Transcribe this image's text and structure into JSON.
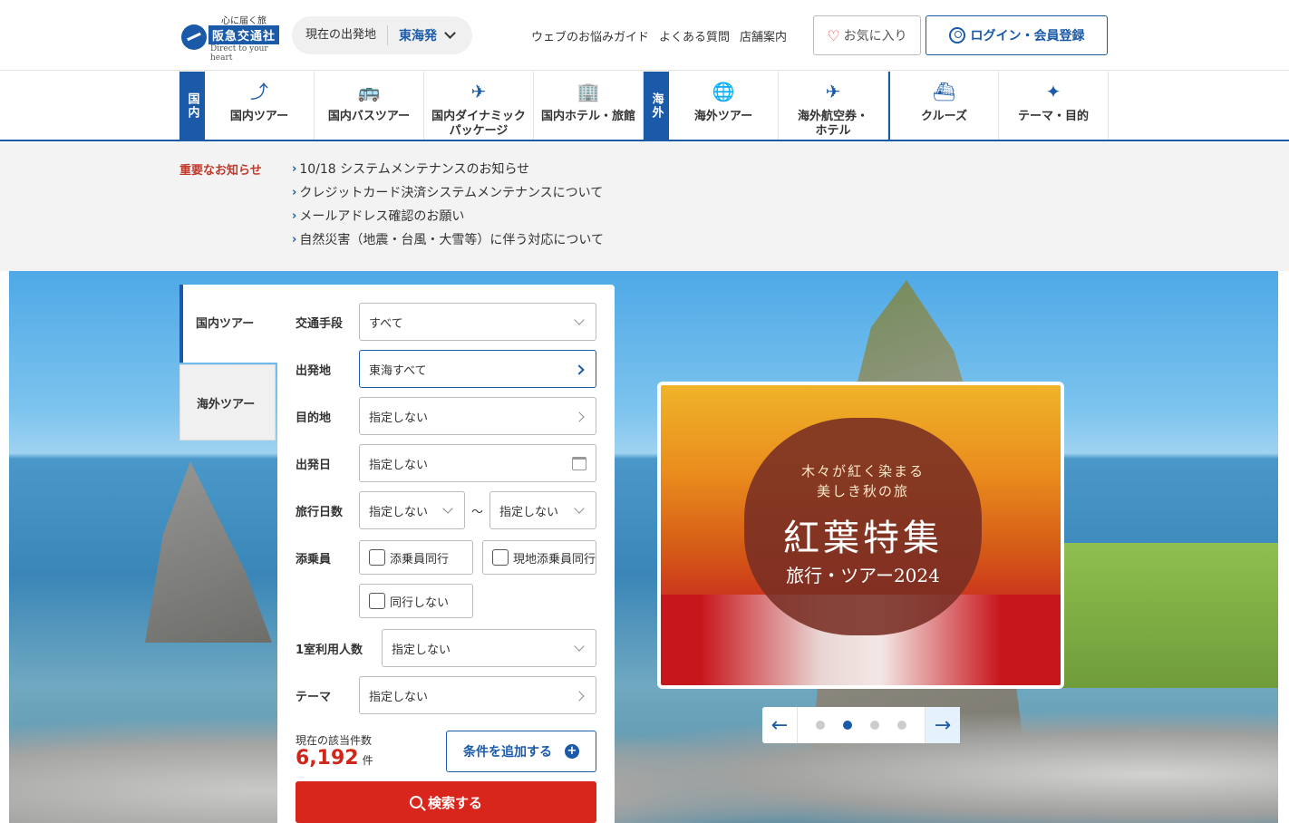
{
  "header": {
    "logo_tag": "心に届く旅",
    "logo_name": "阪急交通社",
    "logo_en": "Direct to your heart",
    "departure_label": "現在の出発地",
    "departure_value": "東海発",
    "links": [
      "ウェブのお悩みガイド",
      "よくある質問",
      "店舗案内"
    ],
    "favorite_label": "お気に入り",
    "login_label": "ログイン・会員登録"
  },
  "nav": {
    "domestic_tab": "国内",
    "overseas_tab": "海外",
    "items": [
      {
        "label": "国内ツアー",
        "icon": "route-icon",
        "glyph": "⤴"
      },
      {
        "label": "国内バスツアー",
        "icon": "bus-icon",
        "glyph": "🚌"
      },
      {
        "label": "国内ダイナミック\nパッケージ",
        "icon": "plane-hotel-icon",
        "glyph": "✈"
      },
      {
        "label": "国内ホテル・旅館",
        "icon": "hotel-icon",
        "glyph": "🏢"
      },
      {
        "label": "海外ツアー",
        "icon": "globe-icon",
        "glyph": "🌐"
      },
      {
        "label": "海外航空券・\nホテル",
        "icon": "plane-hotel-icon",
        "glyph": "✈"
      },
      {
        "label": "クルーズ",
        "icon": "ship-icon",
        "glyph": "⛴"
      },
      {
        "label": "テーマ・目的",
        "icon": "sparkle-icon",
        "glyph": "✦"
      }
    ]
  },
  "notices": {
    "title": "重要なお知らせ",
    "items": [
      "10/18 システムメンテナンスのお知らせ",
      "クレジットカード決済システムメンテナンスについて",
      "メールアドレス確認のお願い",
      "自然災害（地震・台風・大雪等）に伴う対応について"
    ]
  },
  "search": {
    "tab_domestic": "国内ツアー",
    "tab_overseas": "海外ツアー",
    "transport_label": "交通手段",
    "transport_value": "すべて",
    "departure_label": "出発地",
    "departure_value": "東海すべて",
    "destination_label": "目的地",
    "destination_value": "指定しない",
    "date_label": "出発日",
    "date_value": "指定しない",
    "days_label": "旅行日数",
    "days_from": "指定しない",
    "days_sep": "～",
    "days_to": "指定しない",
    "guide_label": "添乗員",
    "guide_opt1": "添乗員同行",
    "guide_opt2": "現地添乗員同行",
    "guide_opt3": "同行しない",
    "room_label": "1室利用人数",
    "room_value": "指定しない",
    "theme_label": "テーマ",
    "theme_value": "指定しない",
    "count_label": "現在の該当件数",
    "count_value": "6,192",
    "count_unit": "件",
    "add_label": "条件を追加する",
    "search_label": "検索する"
  },
  "banner": {
    "line1": "木々が紅く染まる",
    "line2": "美しき秋の旅",
    "title": "紅葉特集",
    "subtitle": "旅行・ツアー2024"
  },
  "carousel": {
    "total": 4,
    "active": 2
  }
}
